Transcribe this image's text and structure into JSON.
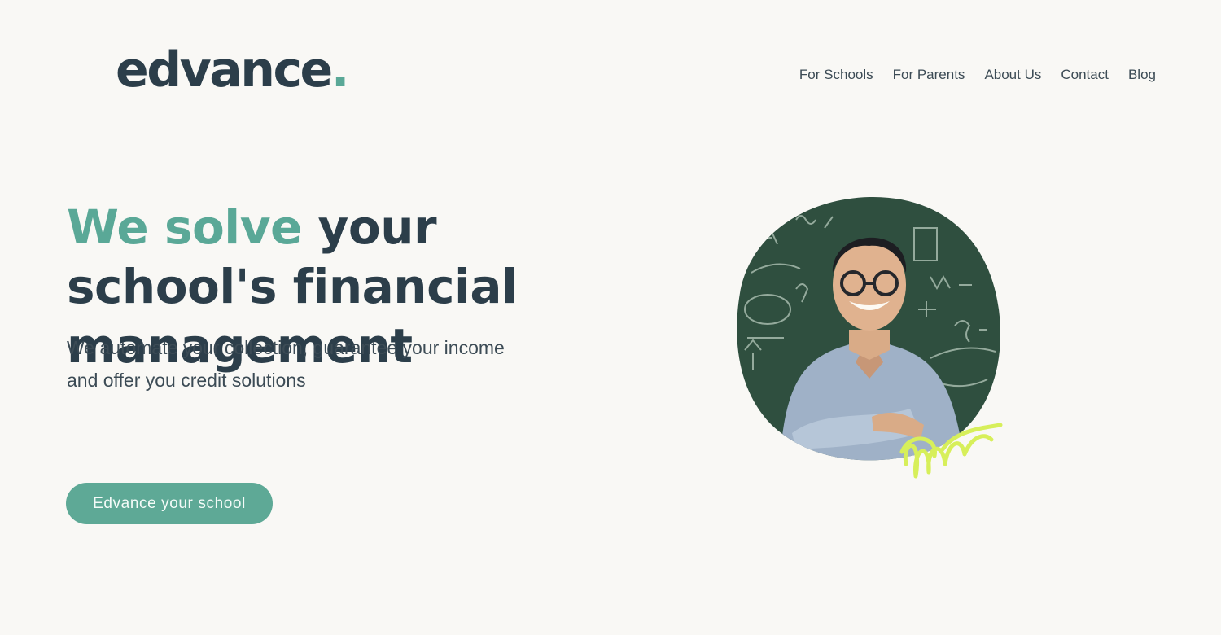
{
  "header": {
    "logo_text": "edvance",
    "logo_dot": ".",
    "nav": [
      "For Schools",
      "For Parents",
      "About Us",
      "Contact",
      "Blog"
    ]
  },
  "hero": {
    "headline_accent": "We solve",
    "headline_rest": " your school's financial management",
    "subtitle_line1": "We automate your collection, guarantee your income",
    "subtitle_line2": "and offer you credit solutions",
    "cta_label": "Edvance your school"
  },
  "colors": {
    "background": "#f9f8f5",
    "text_dark": "#2c3e4a",
    "accent_green": "#5aa897",
    "button_green": "#5ea996",
    "chalkboard": "#2f4f3f",
    "scribble": "#d7ef5a"
  },
  "icons": {
    "photo": "smiling-teacher-portrait",
    "decoration": "lime-scribble"
  }
}
